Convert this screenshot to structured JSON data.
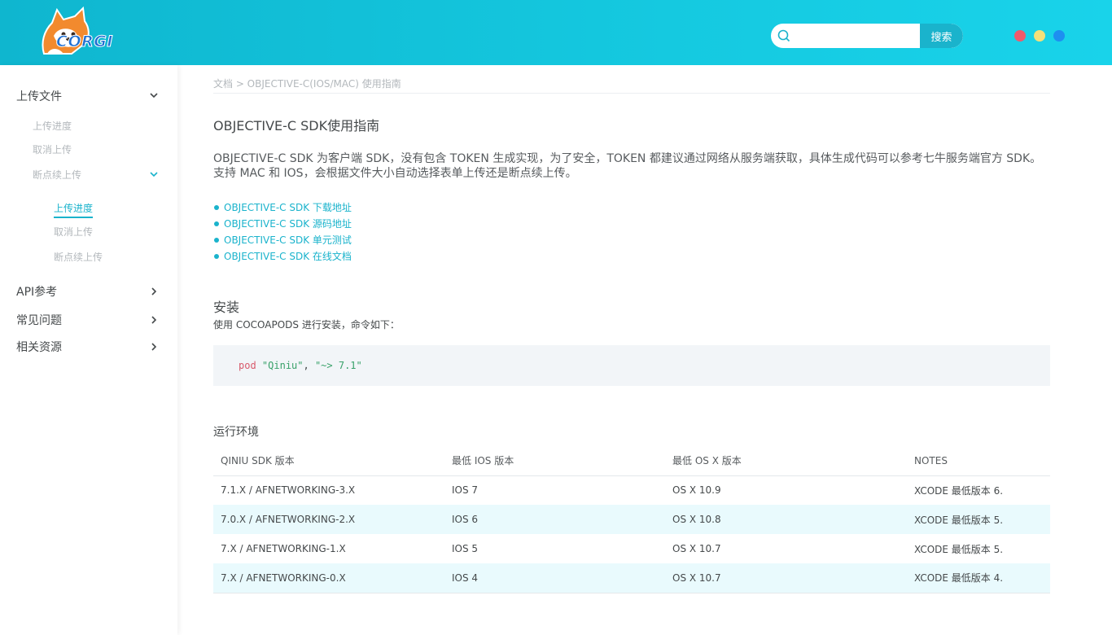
{
  "header": {
    "logo_text": "CORGI",
    "search": {
      "placeholder": "",
      "button_label": "搜索"
    },
    "theme_dots": [
      {
        "color": "#f05a6b"
      },
      {
        "color": "#f5e07a"
      },
      {
        "color": "#1e8ff0"
      }
    ]
  },
  "sidebar": {
    "upload": "上传文件",
    "upload_progress": "上传进度",
    "cancel_upload": "取消上传",
    "resume_upload": "断点续上传",
    "sub_progress": "上传进度",
    "sub_cancel": "取消上传",
    "sub_resume": "断点续上传",
    "api": "API参考",
    "faq": "常见问题",
    "resources": "相关资源"
  },
  "main": {
    "breadcrumb": "文档 > OBJECTIVE-C(IOS/MAC) 使用指南",
    "title": "OBJECTIVE-C SDK使用指南",
    "intro": "OBJECTIVE-C SDK 为客户端 SDK，没有包含 TOKEN 生成实现，为了安全，TOKEN 都建议通过网络从服务端获取，具体生成代码可以参考七牛服务端官方 SDK。支持 MAC 和 IOS，会根据文件大小自动选择表单上传还是断点续上传。",
    "links": [
      "OBJECTIVE-C SDK 下载地址",
      "OBJECTIVE-C SDK 源码地址",
      "OBJECTIVE-C SDK 单元测试",
      "OBJECTIVE-C SDK 在线文档"
    ],
    "install_title": "安装",
    "install_text": "使用 COCOAPODS 进行安装，命令如下：",
    "code": {
      "keyword": "pod",
      "name": "\"Qiniu\"",
      "comma": ", ",
      "version": "\"~> 7.1\""
    },
    "env_title": "运行环境",
    "table": {
      "headers": [
        "QINIU SDK 版本",
        "最低 IOS 版本",
        "最低 OS X 版本",
        "NOTES"
      ],
      "rows": [
        [
          "7.1.X / AFNETWORKING-3.X",
          "IOS 7",
          "OS X 10.9",
          "XCODE 最低版本 6."
        ],
        [
          "7.0.X / AFNETWORKING-2.X",
          "IOS 6",
          "OS X 10.8",
          "XCODE 最低版本 5."
        ],
        [
          "7.X / AFNETWORKING-1.X",
          "IOS 5",
          "OS X 10.7",
          "XCODE 最低版本 5."
        ],
        [
          "7.X / AFNETWORKING-0.X",
          "IOS 4",
          "OS X 10.7",
          "XCODE 最低版本 4."
        ]
      ]
    }
  },
  "colors": {
    "accent": "#1ab3cc",
    "text": "#45494b",
    "muted": "#b3b8bc",
    "link": "#238ffa"
  }
}
